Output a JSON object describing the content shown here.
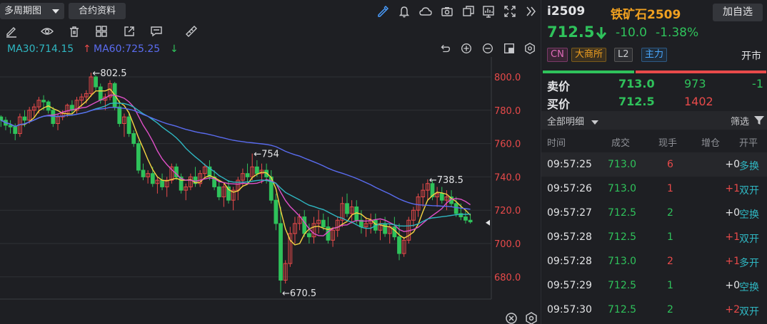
{
  "toolbar": {
    "period_label": "多周期图",
    "contract_label": "合约资料"
  },
  "ma_legend": {
    "ma30": "MA30:714.15",
    "ma60": "MA60:725.25"
  },
  "chart_data": {
    "type": "candlestick",
    "y_ticks": [
      "800.0",
      "780.0",
      "760.0",
      "740.0",
      "720.0",
      "700.0",
      "680.0"
    ],
    "ylim": [
      670.5,
      802.5
    ],
    "annotations": [
      "←802.5",
      "←754",
      "←738.5",
      "←670.5"
    ],
    "colors": {
      "up": "#e84a4a",
      "down": "#2fc25b",
      "ma5": "#f5d442",
      "ma10": "#e050c8",
      "ma20": "#2fb7c2",
      "ma60": "#5a6cf0"
    },
    "candles": [
      [
        776,
        777,
        770,
        774
      ],
      [
        774,
        776,
        768,
        771
      ],
      [
        771,
        774,
        766,
        770
      ],
      [
        770,
        772,
        762,
        766
      ],
      [
        766,
        778,
        764,
        776
      ],
      [
        776,
        780,
        770,
        774
      ],
      [
        774,
        782,
        772,
        780
      ],
      [
        780,
        784,
        776,
        782
      ],
      [
        782,
        788,
        778,
        786
      ],
      [
        786,
        789,
        780,
        785
      ],
      [
        785,
        786,
        778,
        780
      ],
      [
        780,
        782,
        770,
        772
      ],
      [
        772,
        778,
        768,
        776
      ],
      [
        776,
        780,
        774,
        778
      ],
      [
        778,
        784,
        776,
        783
      ],
      [
        783,
        786,
        778,
        780
      ],
      [
        780,
        788,
        778,
        786
      ],
      [
        786,
        790,
        782,
        788
      ],
      [
        788,
        792,
        784,
        790
      ],
      [
        790,
        802.5,
        788,
        800
      ],
      [
        800,
        801,
        792,
        794
      ],
      [
        794,
        796,
        784,
        786
      ],
      [
        786,
        790,
        780,
        788
      ],
      [
        788,
        798,
        786,
        796
      ],
      [
        796,
        797,
        780,
        782
      ],
      [
        782,
        786,
        770,
        772
      ],
      [
        772,
        778,
        764,
        776
      ],
      [
        776,
        778,
        764,
        766
      ],
      [
        766,
        768,
        758,
        760
      ],
      [
        760,
        762,
        742,
        744
      ],
      [
        744,
        748,
        738,
        740
      ],
      [
        740,
        744,
        736,
        742
      ],
      [
        742,
        746,
        734,
        736
      ],
      [
        736,
        740,
        730,
        738
      ],
      [
        738,
        742,
        732,
        734
      ],
      [
        734,
        740,
        728,
        738
      ],
      [
        738,
        748,
        736,
        746
      ],
      [
        746,
        748,
        738,
        740
      ],
      [
        740,
        742,
        730,
        732
      ],
      [
        732,
        736,
        726,
        734
      ],
      [
        734,
        742,
        732,
        740
      ],
      [
        740,
        746,
        734,
        736
      ],
      [
        736,
        744,
        734,
        742
      ],
      [
        742,
        748,
        740,
        746
      ],
      [
        746,
        750,
        738,
        740
      ],
      [
        740,
        744,
        732,
        734
      ],
      [
        734,
        738,
        726,
        728
      ],
      [
        728,
        736,
        722,
        734
      ],
      [
        734,
        738,
        724,
        726
      ],
      [
        726,
        734,
        720,
        732
      ],
      [
        732,
        740,
        726,
        738
      ],
      [
        738,
        745,
        734,
        742
      ],
      [
        742,
        748,
        736,
        740
      ],
      [
        740,
        754,
        738,
        746
      ],
      [
        746,
        750,
        740,
        742
      ],
      [
        742,
        748,
        736,
        744
      ],
      [
        744,
        748,
        736,
        740
      ],
      [
        740,
        744,
        724,
        726
      ],
      [
        726,
        730,
        708,
        712
      ],
      [
        712,
        722,
        670.5,
        678
      ],
      [
        678,
        690,
        676,
        688
      ],
      [
        688,
        710,
        686,
        706
      ],
      [
        706,
        716,
        700,
        712
      ],
      [
        712,
        718,
        708,
        716
      ],
      [
        716,
        720,
        704,
        706
      ],
      [
        706,
        712,
        700,
        704
      ],
      [
        704,
        716,
        700,
        712
      ],
      [
        712,
        720,
        706,
        714
      ],
      [
        714,
        718,
        708,
        710
      ],
      [
        710,
        716,
        700,
        702
      ],
      [
        702,
        710,
        698,
        708
      ],
      [
        708,
        716,
        704,
        714
      ],
      [
        714,
        728,
        710,
        724
      ],
      [
        724,
        730,
        716,
        718
      ],
      [
        718,
        726,
        712,
        722
      ],
      [
        722,
        726,
        712,
        714
      ],
      [
        714,
        720,
        706,
        710
      ],
      [
        710,
        716,
        704,
        712
      ],
      [
        712,
        718,
        706,
        714
      ],
      [
        714,
        718,
        706,
        708
      ],
      [
        708,
        714,
        702,
        712
      ],
      [
        712,
        716,
        704,
        706
      ],
      [
        706,
        712,
        700,
        710
      ],
      [
        710,
        716,
        702,
        704
      ],
      [
        704,
        712,
        690,
        694
      ],
      [
        694,
        704,
        692,
        702
      ],
      [
        702,
        716,
        700,
        714
      ],
      [
        714,
        722,
        710,
        720
      ],
      [
        720,
        730,
        716,
        728
      ],
      [
        728,
        736,
        722,
        732
      ],
      [
        732,
        738.5,
        726,
        736
      ],
      [
        736,
        738,
        726,
        728
      ],
      [
        728,
        734,
        722,
        730
      ],
      [
        730,
        734,
        724,
        726
      ],
      [
        726,
        732,
        720,
        728
      ],
      [
        728,
        732,
        722,
        724
      ],
      [
        724,
        728,
        716,
        718
      ],
      [
        718,
        724,
        714,
        716
      ],
      [
        716,
        720,
        712,
        714
      ],
      [
        714,
        718,
        712,
        713
      ]
    ]
  },
  "quote": {
    "symbol": "i2509",
    "name": "铁矿石2509",
    "add_watch": "加自选",
    "price": "712.5",
    "change": "-10.0",
    "change_pct": "-1.38%",
    "tags": {
      "cn": "CN",
      "exchange": "大商所",
      "level": "L2",
      "main": "主力"
    },
    "status": "开市",
    "sell": {
      "label": "卖价",
      "price": "713.0",
      "volume": "973",
      "diff": "-1"
    },
    "buy": {
      "label": "买价",
      "price": "712.5",
      "volume": "1402"
    }
  },
  "ticks_panel": {
    "filter_all": "全部明细",
    "filter_btn": "筛选",
    "headers": [
      "时间",
      "成交",
      "现手",
      "增仓",
      "开平"
    ],
    "rows": [
      {
        "time": "09:57:25",
        "price": "713.0",
        "qty": "6",
        "oi": "+0",
        "type": "多换",
        "qty_color": "#e84a4a",
        "oi_color": "#e3e4e6",
        "type_color": "#2fb7c2"
      },
      {
        "time": "09:57:26",
        "price": "713.0",
        "qty": "1",
        "oi": "+1",
        "type": "双开",
        "qty_color": "#e84a4a",
        "oi_color": "#e84a4a",
        "type_color": "#2fb7c2"
      },
      {
        "time": "09:57:27",
        "price": "712.5",
        "qty": "2",
        "oi": "+0",
        "type": "空换",
        "qty_color": "#2fc25b",
        "oi_color": "#e3e4e6",
        "type_color": "#2fb7c2"
      },
      {
        "time": "09:57:28",
        "price": "712.5",
        "qty": "1",
        "oi": "+1",
        "type": "双开",
        "qty_color": "#2fc25b",
        "oi_color": "#e84a4a",
        "type_color": "#2fb7c2"
      },
      {
        "time": "09:57:28",
        "price": "713.0",
        "qty": "2",
        "oi": "+1",
        "type": "多开",
        "qty_color": "#e84a4a",
        "oi_color": "#e84a4a",
        "type_color": "#2fb7c2"
      },
      {
        "time": "09:57:29",
        "price": "712.5",
        "qty": "1",
        "oi": "+0",
        "type": "空换",
        "qty_color": "#2fc25b",
        "oi_color": "#e3e4e6",
        "type_color": "#2fb7c2"
      },
      {
        "time": "09:57:30",
        "price": "712.5",
        "qty": "2",
        "oi": "+2",
        "type": "双开",
        "qty_color": "#2fc25b",
        "oi_color": "#e84a4a",
        "type_color": "#2fb7c2"
      }
    ]
  }
}
